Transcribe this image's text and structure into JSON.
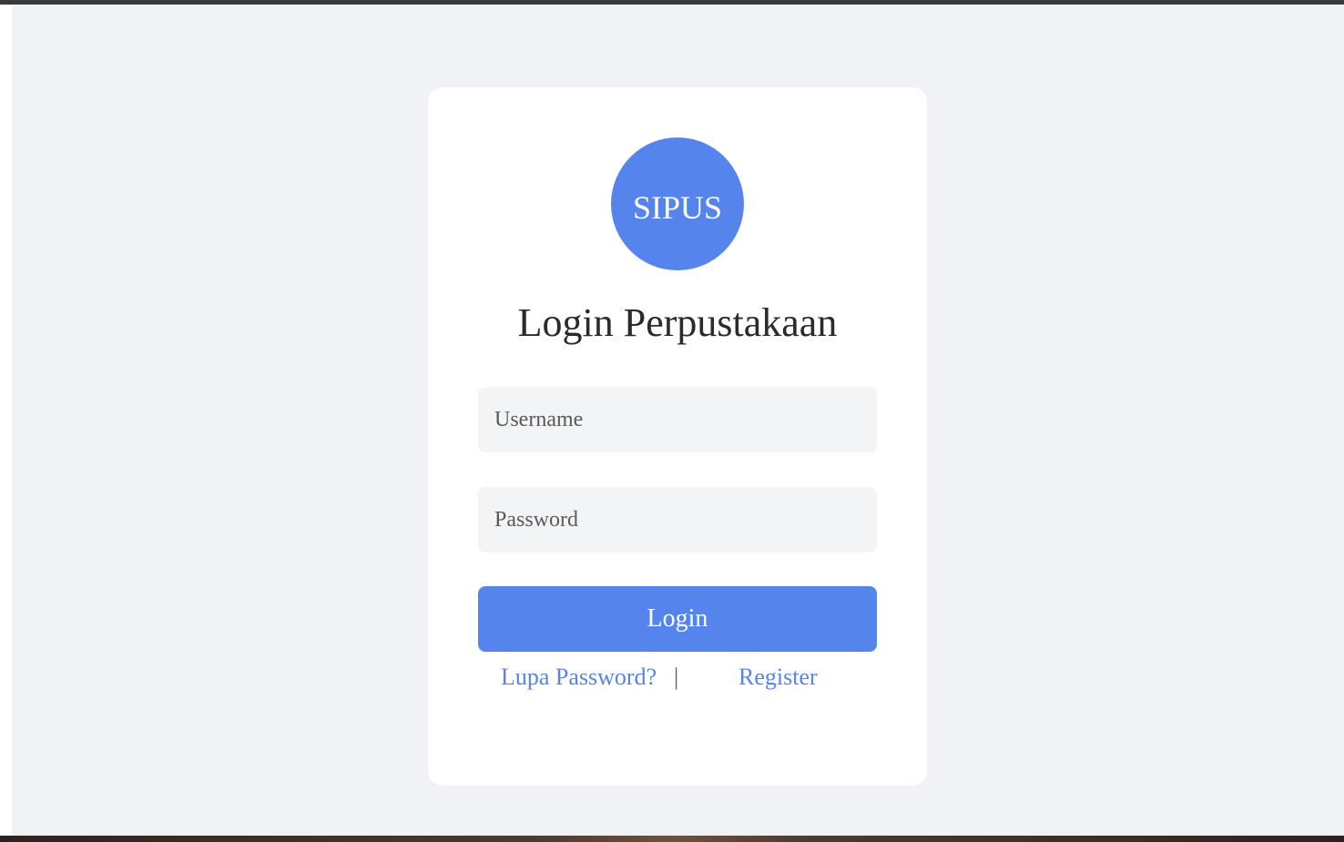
{
  "logo": {
    "text": "SIPUS"
  },
  "title": "Login Perpustakaan",
  "form": {
    "username_placeholder": "Username",
    "password_placeholder": "Password",
    "login_label": "Login"
  },
  "links": {
    "forgot_label": "Lupa Password?",
    "separator": "|",
    "register_label": "Register"
  },
  "colors": {
    "accent": "#5585ec",
    "page_background": "#f0f2f5",
    "card_background": "#ffffff",
    "field_background": "#f3f4f6"
  }
}
